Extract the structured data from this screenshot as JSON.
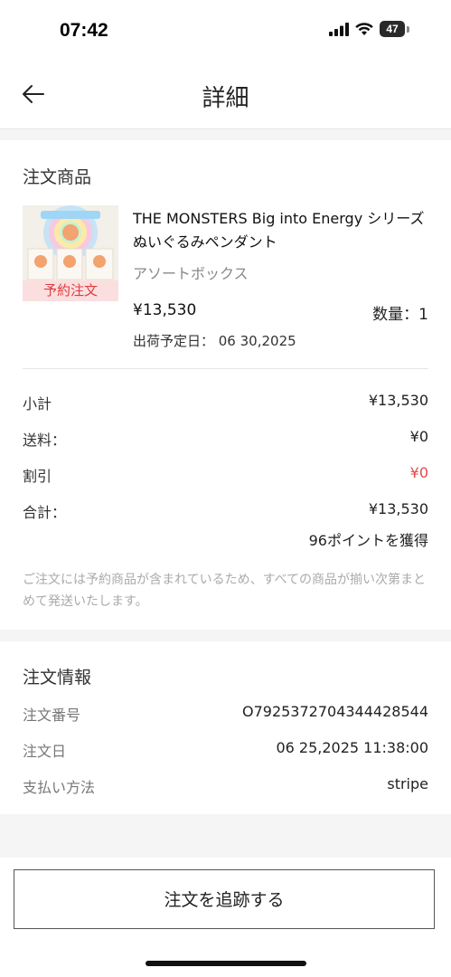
{
  "status_bar": {
    "time": "07:42",
    "battery": "47",
    "signal_icon": "cellular-signal-icon",
    "wifi_icon": "wifi-icon",
    "battery_icon": "battery-icon"
  },
  "nav": {
    "title": "詳細",
    "back_icon": "back-arrow-icon"
  },
  "order_items": {
    "section_title": "注文商品",
    "product": {
      "name": "THE MONSTERS Big into Energy シリーズ ぬいぐるみペンダント",
      "variant": "アソートボックス",
      "badge": "予約注文",
      "price": "¥13,530",
      "quantity": "数量：1",
      "ship_date": "出荷予定日： 06 30,2025"
    },
    "summary": {
      "subtotal_label": "小計",
      "subtotal_value": "¥13,530",
      "shipping_label": "送料：",
      "shipping_value": "¥0",
      "discount_label": "割引",
      "discount_value": "¥0",
      "total_label": "合計：",
      "total_value": "¥13,530",
      "points": "96ポイントを獲得"
    },
    "notice": "ご注文には予約商品が含まれているため、すべての商品が揃い次第まとめて発送いたします。"
  },
  "order_info": {
    "section_title": "注文情報",
    "order_number_label": "注文番号",
    "order_number_value": "O79253727043444285​44",
    "order_date_label": "注文日",
    "order_date_value": "06 25,2025 11:38:00",
    "payment_label": "支払い方法",
    "payment_value": "stripe"
  },
  "actions": {
    "track_label": "注文を追跡する"
  },
  "colors": {
    "accent_red": "#e44b4b",
    "badge_bg": "#fbdfe0",
    "page_bg": "#f5f5f5"
  }
}
